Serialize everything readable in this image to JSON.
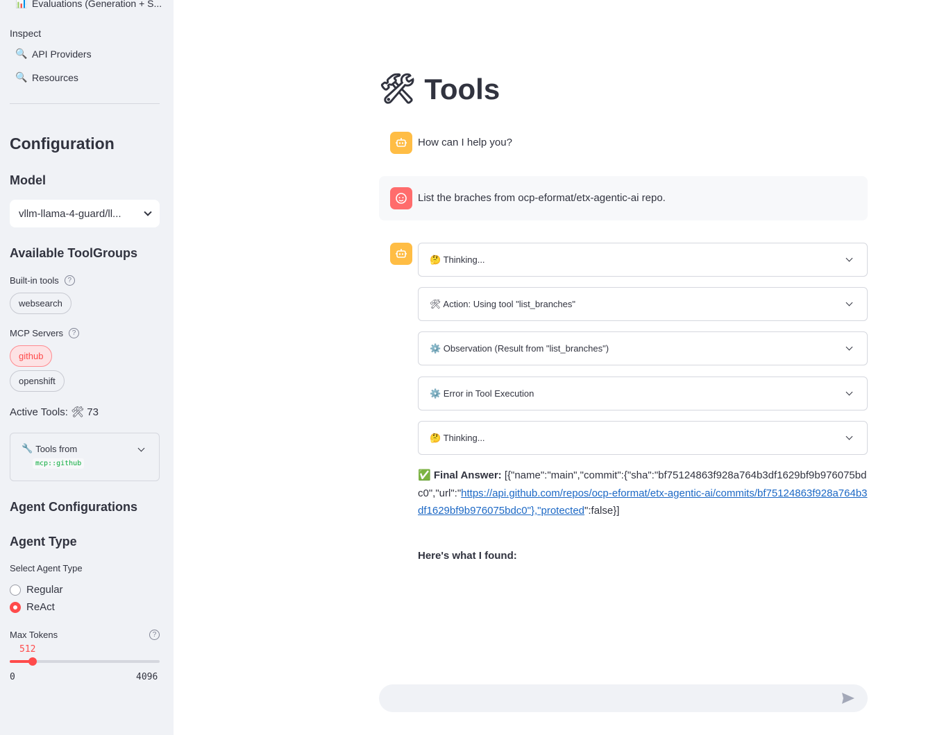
{
  "sidebar": {
    "nav": {
      "evaluations": {
        "icon": "📊",
        "label": "Evaluations (Generation + S..."
      },
      "inspect_label": "Inspect",
      "api_providers": {
        "icon": "🔍",
        "label": "API Providers"
      },
      "resources": {
        "icon": "🔍",
        "label": "Resources"
      }
    },
    "configuration_title": "Configuration",
    "model_title": "Model",
    "model_value": "vllm-llama-4-guard/ll...",
    "toolgroups_title": "Available ToolGroups",
    "builtin_label": "Built-in tools",
    "builtin_tools": [
      "websearch"
    ],
    "mcp_label": "MCP Servers",
    "mcp_servers": [
      {
        "label": "github",
        "selected": true
      },
      {
        "label": "openshift",
        "selected": false
      }
    ],
    "active_tools": "Active Tools: 🛠 73",
    "tools_from": {
      "icon": "🔧",
      "label": "Tools from",
      "code": "mcp::github"
    },
    "agent_config_title": "Agent Configurations",
    "agent_type_title": "Agent Type",
    "select_agent_label": "Select Agent Type",
    "agent_options": [
      {
        "label": "Regular",
        "selected": false
      },
      {
        "label": "ReAct",
        "selected": true
      }
    ],
    "max_tokens": {
      "label": "Max Tokens",
      "value": 512,
      "min": 0,
      "max": 4096,
      "value_text": "512",
      "min_text": "0",
      "max_text": "4096"
    }
  },
  "main": {
    "title_icon": "🛠",
    "title": "Tools",
    "assistant_greeting": "How can I help you?",
    "user_message": "List the braches from ocp-eformat/etx-agentic-ai repo.",
    "steps": [
      "🤔 Thinking...",
      "🛠 Action: Using tool \"list_branches\"",
      "⚙️ Observation (Result from \"list_branches\")",
      "⚙️ Error in Tool Execution",
      "🤔 Thinking..."
    ],
    "final_answer": {
      "check": "✅",
      "label": "Final Answer:",
      "prefix": " [{\"name\":\"main\",\"commit\":{\"sha\":\"bf75124863f928a764b3df1629bf9b976075bdc0\",\"url\":\"",
      "link": "https://api.github.com/repos/ocp-eformat/etx-agentic-ai/commits/bf75124863f928a764b3df1629bf9b976075bdc0\"},\"protected",
      "suffix": "\":false}]"
    },
    "found_text": "Here's what I found:",
    "chat_placeholder": ""
  }
}
